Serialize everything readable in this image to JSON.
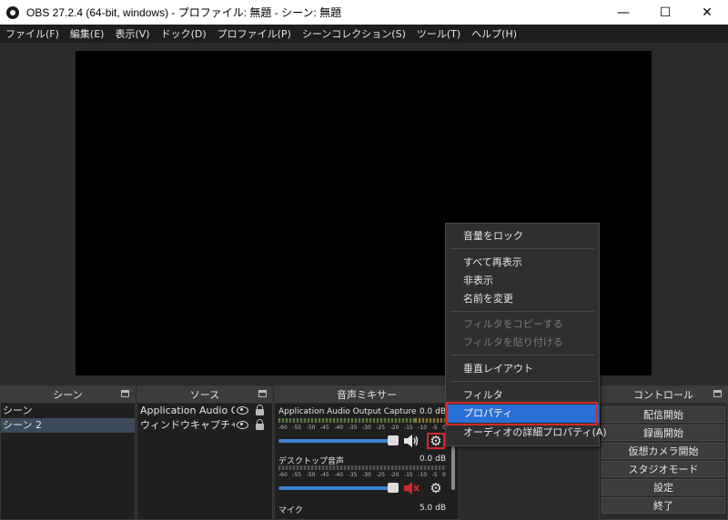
{
  "window": {
    "title": "OBS 27.2.4 (64-bit, windows) - プロファイル: 無題 - シーン: 無題",
    "minimize": "—",
    "maximize": "☐",
    "close": "✕"
  },
  "menubar": {
    "items": [
      "ファイル(F)",
      "編集(E)",
      "表示(V)",
      "ドック(D)",
      "プロファイル(P)",
      "シーンコレクション(S)",
      "ツール(T)",
      "ヘルプ(H)"
    ]
  },
  "docks": {
    "scenes": {
      "title": "シーン",
      "items": [
        "シーン",
        "シーン 2"
      ],
      "selected_index": 1
    },
    "sources": {
      "title": "ソース",
      "items": [
        "Application Audio Output Capture",
        "ウィンドウキャプチャ"
      ]
    },
    "mixer": {
      "title": "音声ミキサー",
      "scale": [
        "-60",
        "-55",
        "-50",
        "-45",
        "-40",
        "-35",
        "-30",
        "-25",
        "-20",
        "-15",
        "-10",
        "-5",
        "0"
      ],
      "channels": [
        {
          "name": "Application Audio Output Capture",
          "db": "0.0 dB",
          "muted": false
        },
        {
          "name": "デスクトップ音声",
          "db": "0.0 dB",
          "muted": true
        },
        {
          "name": "マイク",
          "db": "5.0 dB",
          "muted": false
        }
      ]
    },
    "controls": {
      "title": "コントロール",
      "buttons": [
        "配信開始",
        "録画開始",
        "仮想カメラ開始",
        "スタジオモード",
        "設定",
        "終了"
      ]
    }
  },
  "context_menu": {
    "items": [
      {
        "label": "音量をロック",
        "disabled": false
      },
      {
        "label": "すべて再表示",
        "disabled": false
      },
      {
        "label": "非表示",
        "disabled": false
      },
      {
        "label": "名前を変更",
        "disabled": false
      },
      {
        "label": "フィルタをコピーする",
        "disabled": true
      },
      {
        "label": "フィルタを貼り付ける",
        "disabled": true
      },
      {
        "label": "垂直レイアウト",
        "disabled": false
      },
      {
        "label": "フィルタ",
        "disabled": false
      },
      {
        "label": "プロパティ",
        "disabled": false,
        "active": true
      },
      {
        "label": "オーディオの詳細プロパティ(A)",
        "disabled": false
      }
    ]
  },
  "colors": {
    "highlight": "#2a6fd6",
    "annotation_red": "#d12a2a",
    "meter_green": "#5a7a3a"
  }
}
